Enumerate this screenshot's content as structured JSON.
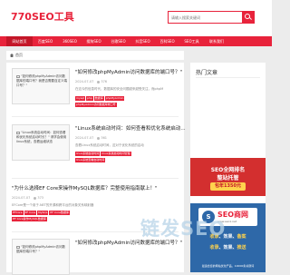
{
  "header": {
    "logo": "770SEO工具",
    "search_placeholder": "请输入搜索关键词"
  },
  "nav": {
    "items": [
      "网站首页",
      "百度SEO",
      "360SEO",
      "搜狗SEO",
      "谷歌SEO",
      "抖音SEO",
      "百科SEO",
      "SEO工具",
      "联系我们"
    ],
    "active_index": 0
  },
  "breadcrumb": {
    "label": "首页"
  },
  "articles": [
    {
      "thumb_text": "\"如何修改phpMyAdmin访问数据库的端口号？我是否需要自定义端口号？\"",
      "title": "\"如何修改phpMyAdmin访问数据库的端口号？\"",
      "date": "2024-07-07",
      "views": "376",
      "desc": "在这今的信息时代，数据库的安全问题越来越受关注，而phpM",
      "tags": [
        "mysql",
        "php",
        "数据库",
        "phpMyAdmin",
        "phpMyAdmin访问数据库端口号"
      ]
    },
    {
      "thumb_text": "\"Linux系统启动时间：如何查看和优化系统启动时长？\" 请学会使用linux系统，查看运维状态",
      "title": "\"Linux系统启动时间：如何查看和优化系统启动...",
      "date": "2024-07-07",
      "views": "361",
      "desc": "查看Linux系统启动时间，这对于优化系统的启动",
      "tags": [
        "linux系统启动时间",
        "linux系统启动时间管理",
        "linux系统查看启动时间"
      ]
    },
    {
      "title": "\"为什么选择EF Core来操作MySQL数据库？完整使用指南献上！\"",
      "date": "2024-07-07",
      "views": "373",
      "desc": "EFCore是一个用于.NET的开源和跨平台的对象关系映射器",
      "tags": [
        "EFCore",
        "EF Core",
        "MySQL",
        "EF Core数据库",
        "EF Core操作MySQL数据库"
      ]
    },
    {
      "thumb_text": "\"如何修改phpMyAdmin访问数据库的端口号？\"",
      "title": "\"如何修改phpMyAdmin访问数据库的端口号？\""
    }
  ],
  "sidebar": {
    "title": "热门文章"
  },
  "ad_seo_hosting": {
    "line1": "SEO全网排名",
    "line2": "整站托管",
    "price": "包年1350元"
  },
  "ad_seo_qiuwang": {
    "brand": "SEO商网",
    "url": "www.seo1.net",
    "row1_a": "收录",
    "row1_b": "效果",
    "row1_c": "备案",
    "row2_a": "收录",
    "row2_b": "效果",
    "row2_c": "推送",
    "footer": "最适合您的网站优化产品，10000条关键词"
  },
  "watermark": "链发SEO"
}
